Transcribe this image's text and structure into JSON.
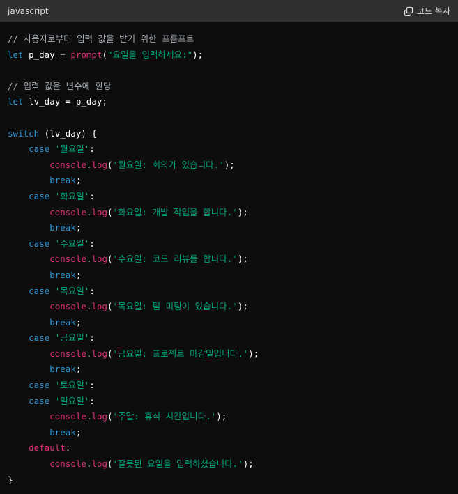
{
  "header": {
    "language": "javascript",
    "copy_label": "코드 복사",
    "copy_icon": "copy-icon"
  },
  "colors": {
    "background": "#0d0d0d",
    "header_background": "#2f2f2f",
    "comment": "#a8b0b8",
    "keyword": "#2e95d3",
    "function": "#df3079",
    "string": "#00a67d",
    "plain": "#ffffff"
  },
  "code": {
    "lines": [
      [
        {
          "t": "comment",
          "v": "// 사용자로부터 입력 값을 받기 위한 프롬프트"
        }
      ],
      [
        {
          "t": "keyword",
          "v": "let"
        },
        {
          "t": "plain",
          "v": " p_day = "
        },
        {
          "t": "fn",
          "v": "prompt"
        },
        {
          "t": "plain",
          "v": "("
        },
        {
          "t": "string",
          "v": "\"요일을 입력하세요:\""
        },
        {
          "t": "plain",
          "v": ");"
        }
      ],
      [],
      [
        {
          "t": "comment",
          "v": "// 입력 값을 변수에 할당"
        }
      ],
      [
        {
          "t": "keyword",
          "v": "let"
        },
        {
          "t": "plain",
          "v": " lv_day = p_day;"
        }
      ],
      [],
      [
        {
          "t": "keyword",
          "v": "switch"
        },
        {
          "t": "plain",
          "v": " (lv_day) {"
        }
      ],
      [
        {
          "t": "plain",
          "v": "    "
        },
        {
          "t": "keyword",
          "v": "case"
        },
        {
          "t": "plain",
          "v": " "
        },
        {
          "t": "string",
          "v": "'월요일'"
        },
        {
          "t": "plain",
          "v": ":"
        }
      ],
      [
        {
          "t": "plain",
          "v": "        "
        },
        {
          "t": "fn",
          "v": "console"
        },
        {
          "t": "plain",
          "v": "."
        },
        {
          "t": "fn",
          "v": "log"
        },
        {
          "t": "plain",
          "v": "("
        },
        {
          "t": "string",
          "v": "'월요일: 회의가 있습니다.'"
        },
        {
          "t": "plain",
          "v": ");"
        }
      ],
      [
        {
          "t": "plain",
          "v": "        "
        },
        {
          "t": "keyword",
          "v": "break"
        },
        {
          "t": "plain",
          "v": ";"
        }
      ],
      [
        {
          "t": "plain",
          "v": "    "
        },
        {
          "t": "keyword",
          "v": "case"
        },
        {
          "t": "plain",
          "v": " "
        },
        {
          "t": "string",
          "v": "'화요일'"
        },
        {
          "t": "plain",
          "v": ":"
        }
      ],
      [
        {
          "t": "plain",
          "v": "        "
        },
        {
          "t": "fn",
          "v": "console"
        },
        {
          "t": "plain",
          "v": "."
        },
        {
          "t": "fn",
          "v": "log"
        },
        {
          "t": "plain",
          "v": "("
        },
        {
          "t": "string",
          "v": "'화요일: 개발 작업을 합니다.'"
        },
        {
          "t": "plain",
          "v": ");"
        }
      ],
      [
        {
          "t": "plain",
          "v": "        "
        },
        {
          "t": "keyword",
          "v": "break"
        },
        {
          "t": "plain",
          "v": ";"
        }
      ],
      [
        {
          "t": "plain",
          "v": "    "
        },
        {
          "t": "keyword",
          "v": "case"
        },
        {
          "t": "plain",
          "v": " "
        },
        {
          "t": "string",
          "v": "'수요일'"
        },
        {
          "t": "plain",
          "v": ":"
        }
      ],
      [
        {
          "t": "plain",
          "v": "        "
        },
        {
          "t": "fn",
          "v": "console"
        },
        {
          "t": "plain",
          "v": "."
        },
        {
          "t": "fn",
          "v": "log"
        },
        {
          "t": "plain",
          "v": "("
        },
        {
          "t": "string",
          "v": "'수요일: 코드 리뷰를 합니다.'"
        },
        {
          "t": "plain",
          "v": ");"
        }
      ],
      [
        {
          "t": "plain",
          "v": "        "
        },
        {
          "t": "keyword",
          "v": "break"
        },
        {
          "t": "plain",
          "v": ";"
        }
      ],
      [
        {
          "t": "plain",
          "v": "    "
        },
        {
          "t": "keyword",
          "v": "case"
        },
        {
          "t": "plain",
          "v": " "
        },
        {
          "t": "string",
          "v": "'목요일'"
        },
        {
          "t": "plain",
          "v": ":"
        }
      ],
      [
        {
          "t": "plain",
          "v": "        "
        },
        {
          "t": "fn",
          "v": "console"
        },
        {
          "t": "plain",
          "v": "."
        },
        {
          "t": "fn",
          "v": "log"
        },
        {
          "t": "plain",
          "v": "("
        },
        {
          "t": "string",
          "v": "'목요일: 팀 미팅이 있습니다.'"
        },
        {
          "t": "plain",
          "v": ");"
        }
      ],
      [
        {
          "t": "plain",
          "v": "        "
        },
        {
          "t": "keyword",
          "v": "break"
        },
        {
          "t": "plain",
          "v": ";"
        }
      ],
      [
        {
          "t": "plain",
          "v": "    "
        },
        {
          "t": "keyword",
          "v": "case"
        },
        {
          "t": "plain",
          "v": " "
        },
        {
          "t": "string",
          "v": "'금요일'"
        },
        {
          "t": "plain",
          "v": ":"
        }
      ],
      [
        {
          "t": "plain",
          "v": "        "
        },
        {
          "t": "fn",
          "v": "console"
        },
        {
          "t": "plain",
          "v": "."
        },
        {
          "t": "fn",
          "v": "log"
        },
        {
          "t": "plain",
          "v": "("
        },
        {
          "t": "string",
          "v": "'금요일: 프로젝트 마감일입니다.'"
        },
        {
          "t": "plain",
          "v": ");"
        }
      ],
      [
        {
          "t": "plain",
          "v": "        "
        },
        {
          "t": "keyword",
          "v": "break"
        },
        {
          "t": "plain",
          "v": ";"
        }
      ],
      [
        {
          "t": "plain",
          "v": "    "
        },
        {
          "t": "keyword",
          "v": "case"
        },
        {
          "t": "plain",
          "v": " "
        },
        {
          "t": "string",
          "v": "'토요일'"
        },
        {
          "t": "plain",
          "v": ":"
        }
      ],
      [
        {
          "t": "plain",
          "v": "    "
        },
        {
          "t": "keyword",
          "v": "case"
        },
        {
          "t": "plain",
          "v": " "
        },
        {
          "t": "string",
          "v": "'일요일'"
        },
        {
          "t": "plain",
          "v": ":"
        }
      ],
      [
        {
          "t": "plain",
          "v": "        "
        },
        {
          "t": "fn",
          "v": "console"
        },
        {
          "t": "plain",
          "v": "."
        },
        {
          "t": "fn",
          "v": "log"
        },
        {
          "t": "plain",
          "v": "("
        },
        {
          "t": "string",
          "v": "'주말: 휴식 시간입니다.'"
        },
        {
          "t": "plain",
          "v": ");"
        }
      ],
      [
        {
          "t": "plain",
          "v": "        "
        },
        {
          "t": "keyword",
          "v": "break"
        },
        {
          "t": "plain",
          "v": ";"
        }
      ],
      [
        {
          "t": "plain",
          "v": "    "
        },
        {
          "t": "fn",
          "v": "default"
        },
        {
          "t": "plain",
          "v": ":"
        }
      ],
      [
        {
          "t": "plain",
          "v": "        "
        },
        {
          "t": "fn",
          "v": "console"
        },
        {
          "t": "plain",
          "v": "."
        },
        {
          "t": "fn",
          "v": "log"
        },
        {
          "t": "plain",
          "v": "("
        },
        {
          "t": "string",
          "v": "'잘못된 요일을 입력하셨습니다.'"
        },
        {
          "t": "plain",
          "v": ");"
        }
      ],
      [
        {
          "t": "plain",
          "v": "}"
        }
      ]
    ]
  }
}
